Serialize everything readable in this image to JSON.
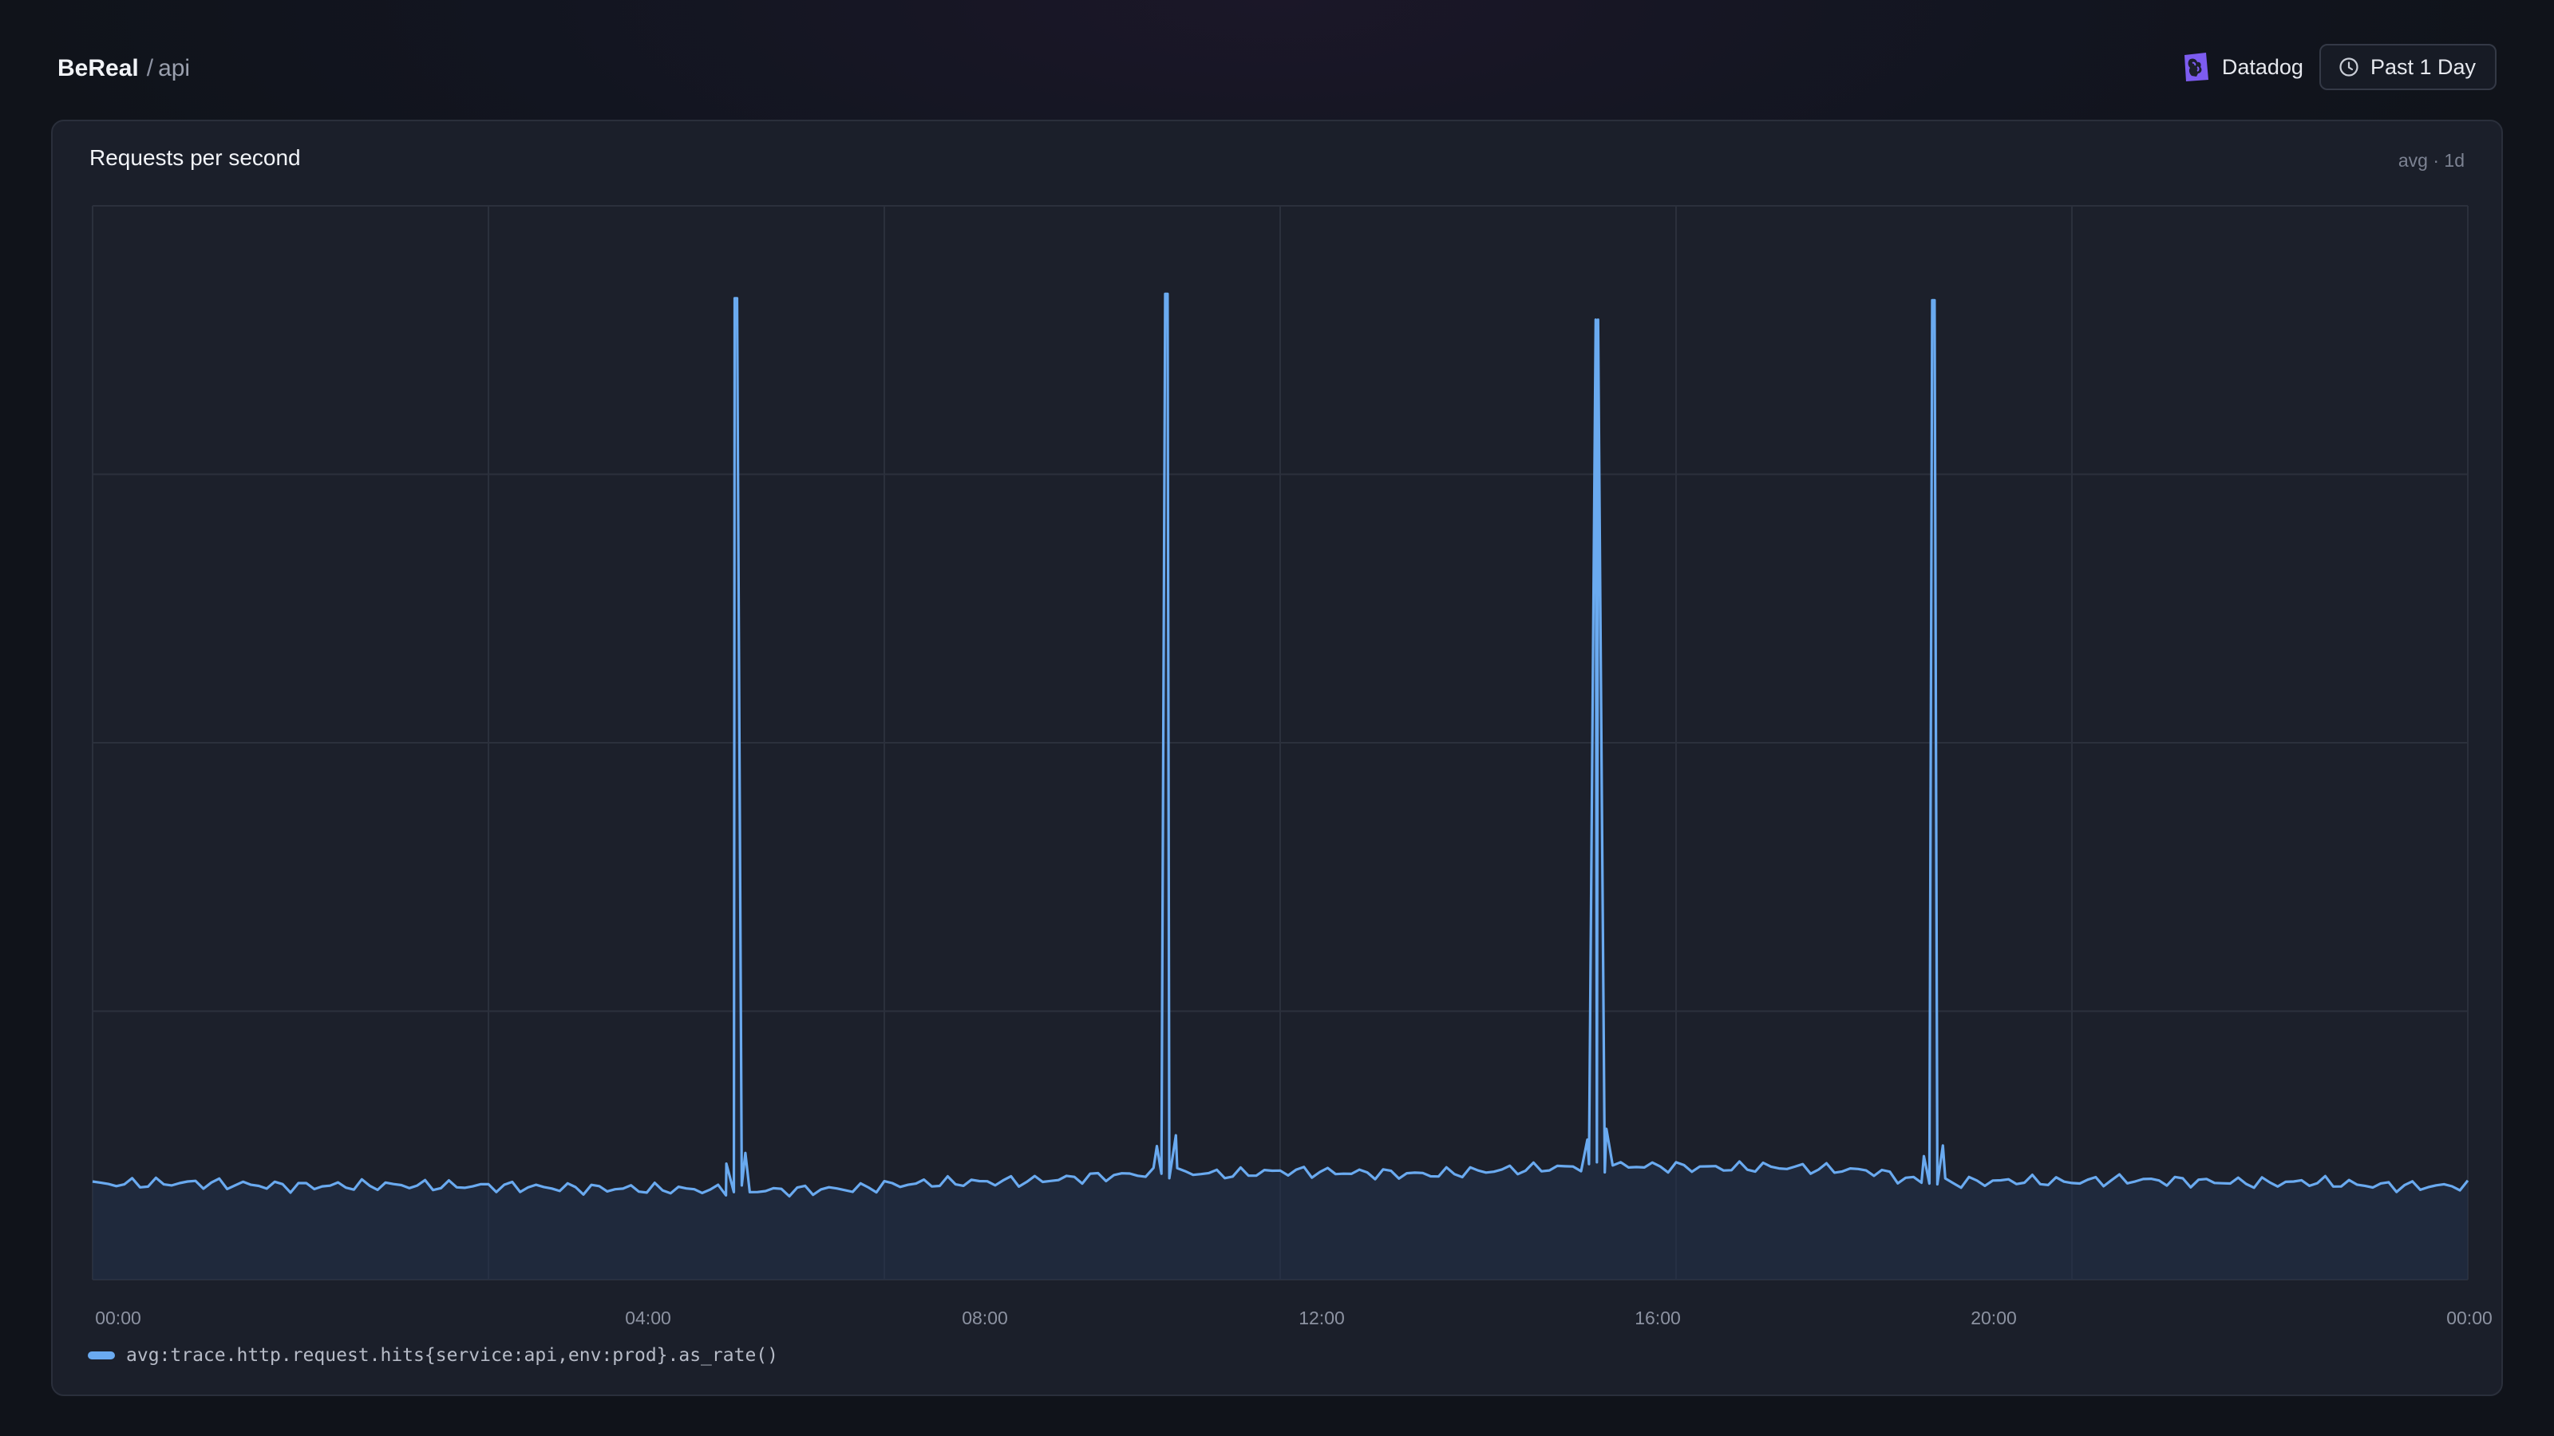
{
  "breadcrumb": {
    "org": "BeReal",
    "separator": "/",
    "service": "api"
  },
  "topbar": {
    "provider": {
      "icon": "datadog-logo-icon",
      "label": "Datadog"
    },
    "time_range": {
      "icon": "clock-icon",
      "label": "Past 1 Day"
    }
  },
  "panel": {
    "title": "Requests per second",
    "meta": "avg · 1d",
    "legend": "avg:trace.http.request.hits{service:api,env:prod}.as_rate()"
  },
  "colors": {
    "series": "#6aaaf0",
    "accent": "#7d5cf0",
    "grid": "#2b303c",
    "card_bg": "#1b1f2a"
  },
  "chart_data": {
    "type": "area",
    "x_ticks": [
      "00:00",
      "04:00",
      "08:00",
      "12:00",
      "16:00",
      "20:00",
      "00:00"
    ],
    "grid": true,
    "legend_placement": "bottom-left",
    "ylim": [
      0,
      100
    ],
    "series": [
      {
        "x": [
          0,
          1,
          2,
          3,
          4,
          5,
          6,
          6.5,
          7,
          7.8,
          8,
          8.5,
          9,
          9.5,
          10,
          10.5,
          11,
          11.5,
          12,
          12.5,
          13,
          13.5,
          14,
          14.5,
          15,
          15.5,
          16,
          16.5,
          17,
          17.5,
          17.8,
          18,
          18.3,
          18.6,
          19,
          19.5,
          20,
          20.5,
          21,
          21.5,
          22,
          22.5,
          22.8,
          23,
          23.4,
          23.8,
          24
        ],
        "values": [
          8.9,
          9.0,
          8.7,
          8.8,
          8.7,
          8.5,
          8.4,
          8.3,
          8.3,
          8.5,
          8.8,
          9.0,
          9.1,
          9.2,
          9.5,
          9.8,
          10.0,
          9.8,
          10.1,
          10.0,
          9.9,
          9.8,
          10.1,
          10.3,
          10.5,
          10.6,
          10.5,
          10.4,
          10.5,
          10.3,
          10.2,
          10.1,
          9.4,
          9.0,
          9.1,
          9.2,
          9.1,
          9.3,
          9.2,
          9.1,
          9.0,
          9.1,
          8.9,
          8.8,
          8.7,
          8.7,
          8.8
        ],
        "spikes": [
          {
            "x": 6.5,
            "value": 91.4
          },
          {
            "x": 10.85,
            "value": 91.8
          },
          {
            "x": 15.2,
            "value": 89.4
          },
          {
            "x": 18.6,
            "value": 91.2
          }
        ]
      }
    ]
  }
}
